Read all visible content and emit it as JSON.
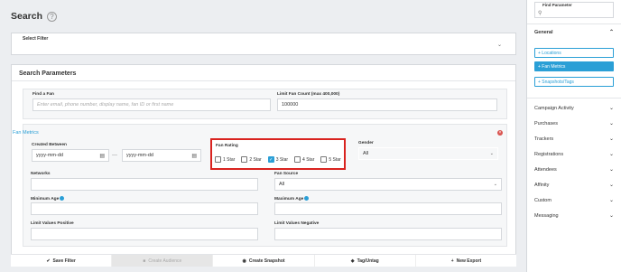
{
  "header": {
    "title": "Search"
  },
  "select_filter": {
    "label": "Select Filter"
  },
  "params": {
    "title": "Search Parameters",
    "find_fan": {
      "label": "Find a Fan",
      "placeholder": "Enter email, phone number, display name, fan ID or first name"
    },
    "limit": {
      "label": "Limit Fan Count (max 400,000)",
      "value": "100000"
    },
    "fan_metrics": {
      "title": "Fan Metrics",
      "created_between": {
        "label": "Created Between",
        "from": "yyyy-mm-dd",
        "to": "yyyy-mm-dd",
        "separator": "—"
      },
      "fan_rating": {
        "label": "Fan Rating",
        "options": [
          {
            "label": "1 Star",
            "checked": false
          },
          {
            "label": "2 Star",
            "checked": false
          },
          {
            "label": "3 Star",
            "checked": true
          },
          {
            "label": "4 Star",
            "checked": false
          },
          {
            "label": "5 Star",
            "checked": false
          }
        ]
      },
      "gender": {
        "label": "Gender",
        "value": "All"
      },
      "networks": {
        "label": "Networks"
      },
      "fan_source": {
        "label": "Fan Source",
        "value": "All"
      },
      "minimum_age": {
        "label": "Minimum Age"
      },
      "maximum_age": {
        "label": "Maximum Age"
      },
      "limit_positive": {
        "label": "Limit Values Positive"
      },
      "limit_negative": {
        "label": "Limit Values Negative"
      }
    }
  },
  "toolbar": {
    "save_filter": "Save Filter",
    "create_audience": "Create Audience",
    "create_snapshot": "Create Snapshot",
    "tag_untag": "Tag/Untag",
    "new_export": "New Export"
  },
  "sidebar": {
    "find_parameter": "Find Parameter",
    "general": {
      "label": "General",
      "items": [
        {
          "label": "+ Locations",
          "active": false
        },
        {
          "label": "+ Fan Metrics",
          "active": true
        },
        {
          "label": "+ Snapshots/Tags",
          "active": false
        }
      ]
    },
    "categories": [
      "Campaign Activity",
      "Purchases",
      "Trackers",
      "Registrations",
      "Attendees",
      "Affinity",
      "Custom",
      "Messaging"
    ]
  },
  "colors": {
    "accent": "#2a9fd6",
    "highlight": "#d9231f"
  }
}
